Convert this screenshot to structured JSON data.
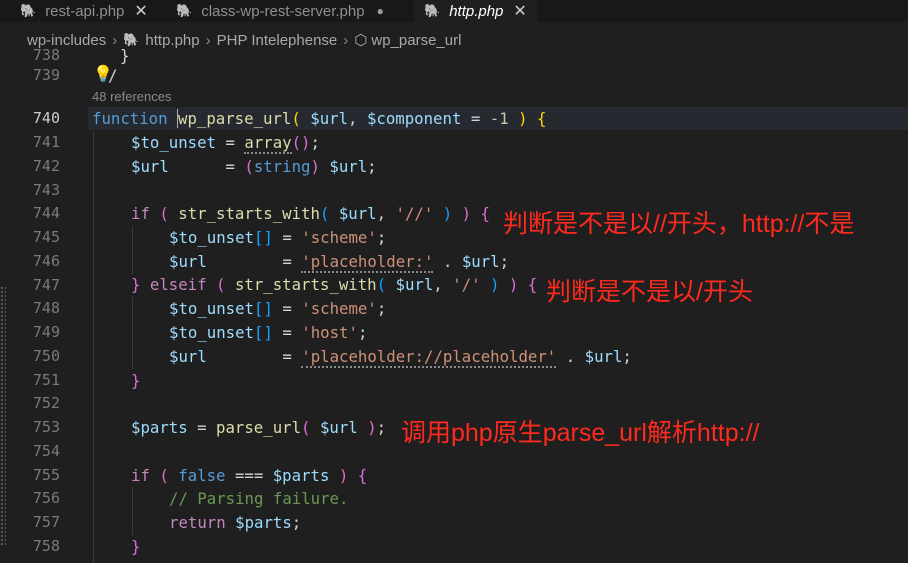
{
  "tabs": [
    {
      "label": "rest-api.php",
      "close": "✕"
    },
    {
      "label": "class-wp-rest-server.php",
      "dirty": "●"
    },
    {
      "label": "http.php",
      "close": "✕"
    }
  ],
  "breadcrumb": {
    "items": [
      "wp-includes",
      "http.php",
      "PHP Intelephense",
      "wp_parse_url"
    ],
    "separator": "›"
  },
  "codelens": "48 references",
  "line_numbers": [
    "738",
    "739",
    "740",
    "741",
    "742",
    "743",
    "744",
    "745",
    "746",
    "747",
    "748",
    "749",
    "750",
    "751",
    "752",
    "753",
    "754",
    "755",
    "756",
    "757",
    "758"
  ],
  "code": {
    "l738": "}",
    "l739": "/",
    "l740": {
      "kw": "function",
      "name": "wp_parse_url",
      "p1": "$url",
      "p2": "$component",
      "eq": "=",
      "num": "-1"
    },
    "l741": {
      "var": "$to_unset",
      "eq": "=",
      "fn": "array"
    },
    "l742": {
      "var": "$url",
      "eq": "=",
      "cast": "string",
      "var2": "$url"
    },
    "l744": {
      "kw": "if",
      "fn": "str_starts_with",
      "var": "$url",
      "str": "'//'"
    },
    "l745": {
      "var": "$to_unset",
      "eq": "=",
      "str": "'scheme'"
    },
    "l746": {
      "var": "$url",
      "eq": "=",
      "str": "'placeholder:'",
      "op": ".",
      "var2": "$url"
    },
    "l747": {
      "kw": "elseif",
      "fn": "str_starts_with",
      "var": "$url",
      "str": "'/'"
    },
    "l748": {
      "var": "$to_unset",
      "eq": "=",
      "str": "'scheme'"
    },
    "l749": {
      "var": "$to_unset",
      "eq": "=",
      "str": "'host'"
    },
    "l750": {
      "var": "$url",
      "eq": "=",
      "str": "'placeholder://placeholder'",
      "op": ".",
      "var2": "$url"
    },
    "l753": {
      "var": "$parts",
      "eq": "=",
      "fn": "parse_url",
      "var2": "$url"
    },
    "l755": {
      "kw": "if",
      "const": "false",
      "op": "===",
      "var": "$parts"
    },
    "l756": "// Parsing failure.",
    "l757": {
      "kw": "return",
      "var": "$parts"
    }
  },
  "annotations": [
    "判断是不是以//开头，http://不是",
    "判断是不是以/开头",
    "调用php原生parse_url解析http://"
  ],
  "colors": {
    "annotation": "#ff2a1f",
    "background": "#1f1f1f"
  }
}
